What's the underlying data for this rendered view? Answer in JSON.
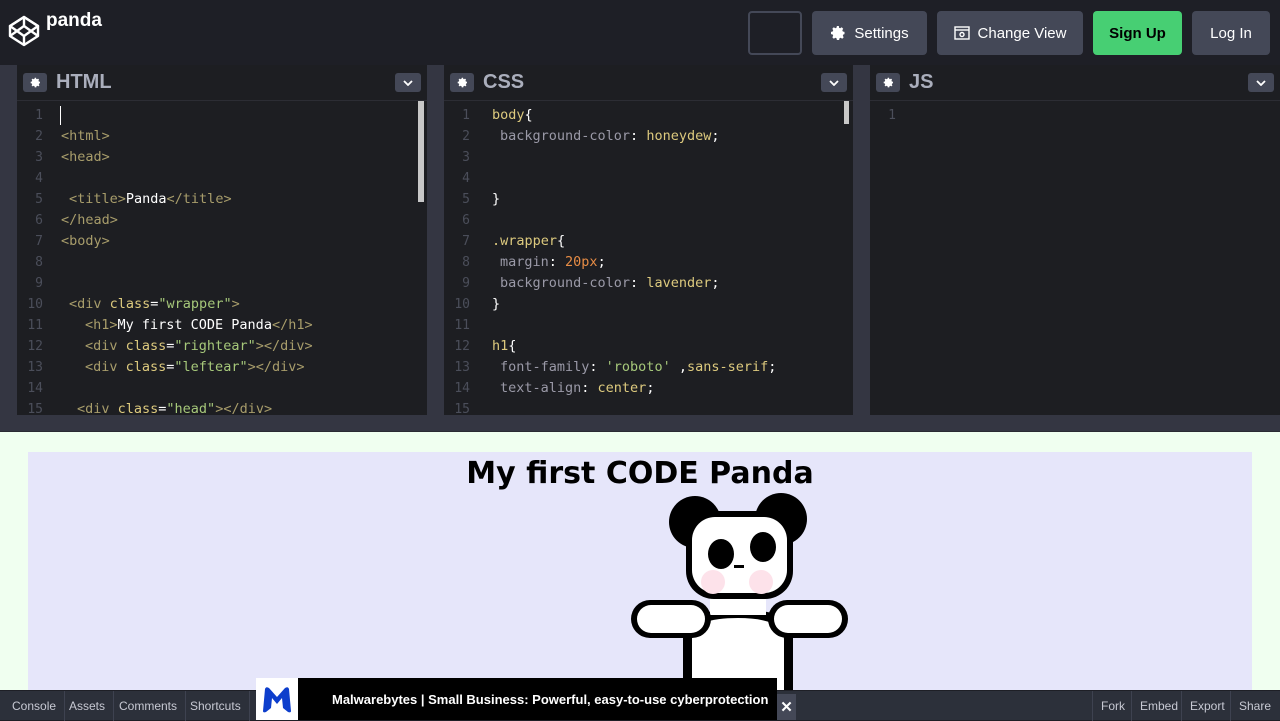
{
  "header": {
    "pen_title": "panda",
    "settings_label": "Settings",
    "change_view_label": "Change View",
    "signup_label": "Sign Up",
    "login_label": "Log In"
  },
  "editors": {
    "html": {
      "title": "HTML",
      "line_numbers": [
        "1",
        "2",
        "3",
        "4",
        "5",
        "6",
        "7",
        "8",
        "9",
        "10",
        "11",
        "12",
        "13",
        "14",
        "15"
      ]
    },
    "css": {
      "title": "CSS",
      "line_numbers": [
        "1",
        "2",
        "3",
        "4",
        "5",
        "6",
        "7",
        "8",
        "9",
        "10",
        "11",
        "12",
        "13",
        "14",
        "15"
      ]
    },
    "js": {
      "title": "JS",
      "line_numbers": [
        "1"
      ]
    }
  },
  "html_code": {
    "l2": "<html>",
    "l3": "<head>",
    "l5_open": "<title>",
    "l5_text": "Panda",
    "l5_close": "</title>",
    "l6": "</head>",
    "l7": "<body>",
    "l10_a": "<div ",
    "l10_attr": "class",
    "l10_eq": "=",
    "l10_str": "\"wrapper\"",
    "l10_b": ">",
    "l11_open": "<h1>",
    "l11_text": "My first CODE Panda",
    "l11_close": "</h1>",
    "l12_a": "<div ",
    "l12_attr": "class",
    "l12_eq": "=",
    "l12_str": "\"rightear\"",
    "l12_b": "></div>",
    "l13_a": "<div ",
    "l13_attr": "class",
    "l13_eq": "=",
    "l13_str": "\"leftear\"",
    "l13_b": "></div>",
    "l15_a": "<div ",
    "l15_attr": "class",
    "l15_eq": "=",
    "l15_str": "\"head\"",
    "l15_b": "></div>"
  },
  "css_code": {
    "l1_sel": "body",
    "l1_brace": "{",
    "l2_prop": "background-color",
    "l2_colon": ": ",
    "l2_val": "honeydew",
    "l2_semi": ";",
    "l5": "}",
    "l7_sel": ".wrapper",
    "l7_brace": "{",
    "l8_prop": "margin",
    "l8_colon": ": ",
    "l8_val": "20px",
    "l8_semi": ";",
    "l9_prop": "background-color",
    "l9_colon": ": ",
    "l9_val": "lavender",
    "l9_semi": ";",
    "l10": "}",
    "l12_sel": "h1",
    "l12_brace": "{",
    "l13_prop": "font-family",
    "l13_colon": ": ",
    "l13_str": "'roboto'",
    "l13_comma": " ,",
    "l13_val": "sans-serif",
    "l13_semi": ";",
    "l14_prop": "text-align",
    "l14_colon": ": ",
    "l14_val": "center",
    "l14_semi": ";"
  },
  "preview": {
    "heading": "My first CODE Panda"
  },
  "bottom_bar": {
    "console": "Console",
    "assets": "Assets",
    "comments": "Comments",
    "shortcuts": "Shortcuts",
    "fork": "Fork",
    "embed": "Embed",
    "export": "Export",
    "share": "Share"
  },
  "ad": {
    "text": "Malwarebytes | Small Business: Powerful, easy-to-use cyberprotection",
    "close": "✕"
  },
  "colors": {
    "signup": "#47cf73",
    "button_bg": "#444857",
    "preview_bg": "#f0fff0",
    "wrapper_bg": "#e6e6fa"
  }
}
